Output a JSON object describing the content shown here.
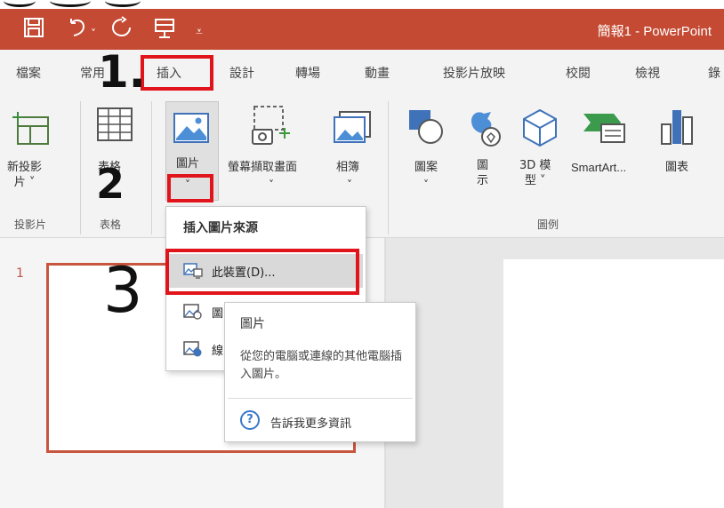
{
  "app": {
    "title": "簡報1 - PowerPoint",
    "accent_color": "#c44a33"
  },
  "quick_access": {
    "save_icon": "save-icon",
    "undo_icon": "undo-icon",
    "redo_icon": "redo-icon",
    "present_icon": "present-icon",
    "customize_icon": "customize-icon"
  },
  "tabs": [
    {
      "label": "檔案"
    },
    {
      "label": "常用"
    },
    {
      "label": "插入",
      "active": true
    },
    {
      "label": "設計"
    },
    {
      "label": "轉場"
    },
    {
      "label": "動畫"
    },
    {
      "label": "投影片放映"
    },
    {
      "label": "校閱"
    },
    {
      "label": "檢視"
    },
    {
      "label": "錄"
    }
  ],
  "ribbon": {
    "new_slide": {
      "line1": "新投影",
      "line2": "片 ˅"
    },
    "table": {
      "label": "表格"
    },
    "pictures": {
      "label": "圖片",
      "caret": "˅"
    },
    "screenshot": {
      "label": "螢幕擷取畫面",
      "caret": "˅"
    },
    "album": {
      "label": "相簿",
      "caret": "˅"
    },
    "shapes": {
      "label": "圖案",
      "caret": "˅"
    },
    "icons": {
      "line1": "圖",
      "line2": "示"
    },
    "models3d": {
      "line1": "3D 模",
      "line2": "型 ˅"
    },
    "smartart": {
      "label": "SmartArt..."
    },
    "chart": {
      "label": "圖表"
    },
    "groups": {
      "slides": "投影片",
      "tables": "表格",
      "illustrations": "圖例"
    }
  },
  "dropdown": {
    "header": "插入圖片來源",
    "items": [
      {
        "label": "此裝置(D)...",
        "icon": "device-image-icon",
        "highlighted": true
      },
      {
        "label": "圖",
        "icon": "stock-image-icon"
      },
      {
        "label": "線",
        "icon": "online-image-icon"
      }
    ]
  },
  "tooltip": {
    "title": "圖片",
    "description": "從您的電腦或連線的其他電腦插入圖片。",
    "help_label": "告訴我更多資訊",
    "help_icon": "help-icon"
  },
  "slides_pane": {
    "slide_number": "1"
  },
  "annotations": {
    "step1": "1.",
    "step2": "2",
    "step3": "3"
  }
}
